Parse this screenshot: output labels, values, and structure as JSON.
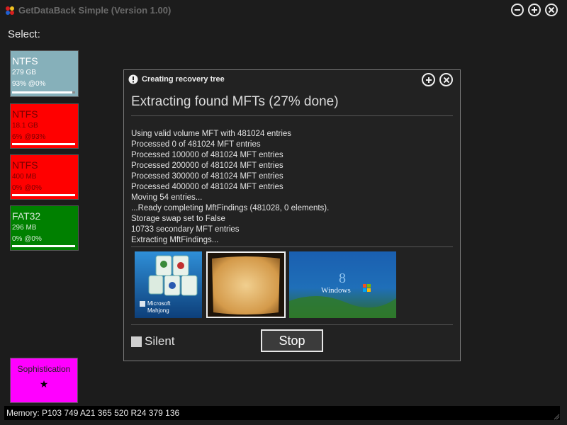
{
  "app": {
    "title": "GetDataBack Simple (Version 1.00)"
  },
  "select_label": "Select:",
  "drives": [
    {
      "fs": "NTFS",
      "size": "279 GB",
      "progress": "93% @0%",
      "bar_fraction": 0.95,
      "bg": "#86b0ba",
      "fg": "#ffffff"
    },
    {
      "fs": "NTFS",
      "size": "18.1 GB",
      "progress": "6% @93%",
      "bar_fraction": 1.0,
      "bg": "#ff0000",
      "fg": "#7a0000"
    },
    {
      "fs": "NTFS",
      "size": "400 MB",
      "progress": "0% @0%",
      "bar_fraction": 1.0,
      "bg": "#ff0000",
      "fg": "#7a0000"
    },
    {
      "fs": "FAT32",
      "size": "296 MB",
      "progress": "0% @0%",
      "bar_fraction": 1.0,
      "bg": "#008000",
      "fg": "#d4e8d4"
    }
  ],
  "sophistication": {
    "label": "Sophistication",
    "star": "★",
    "color": "#ff00ff"
  },
  "status": {
    "memory": "Memory: P103 749 A21 365 520 R24 379 136"
  },
  "dialog": {
    "title": "Creating recovery tree",
    "heading": "Extracting found MFTs (27% done)",
    "log": [
      "Using valid volume MFT with 481024 entries",
      "Processed 0 of 481024 MFT entries",
      "Processed 100000 of 481024 MFT entries",
      "Processed 200000 of 481024 MFT entries",
      "Processed 300000 of 481024 MFT entries",
      "Processed 400000 of 481024 MFT entries",
      "Moving 54 entries...",
      "...Ready completing MftFindings (481028, 0 elements).",
      "Storage swap set to False",
      "10733 secondary MFT entries",
      "Extracting MftFindings..."
    ],
    "thumbnails": [
      {
        "caption_line1": "Microsoft",
        "caption_line2": "Mahjong"
      },
      {
        "caption_line1": "",
        "caption_line2": ""
      },
      {
        "caption_line1": "Windows",
        "caption_line2": "8"
      }
    ],
    "silent_label": "Silent",
    "stop_label": "Stop"
  }
}
